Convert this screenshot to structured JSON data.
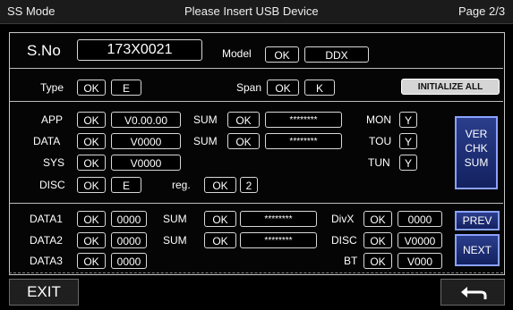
{
  "header": {
    "mode": "SS Mode",
    "message": "Please Insert USB Device",
    "page": "Page 2/3"
  },
  "info": {
    "sno_label": "S.No",
    "sno_value": "173X0021",
    "model_label": "Model",
    "model_status": "OK",
    "model_value": "DDX",
    "type_label": "Type",
    "type_status": "OK",
    "type_value": "E",
    "span_label": "Span",
    "span_status": "OK",
    "span_value": "K",
    "initialize_label": "INITIALIZE ALL"
  },
  "firmware": {
    "app_label": "APP",
    "app_status": "OK",
    "app_value": "V0.00.00",
    "data_label": "DATA",
    "data_status": "OK",
    "data_value": "V0000",
    "sys_label": "SYS",
    "sys_status": "OK",
    "sys_value": "V0000",
    "disc_label": "DISC",
    "disc_status": "OK",
    "disc_value": "E",
    "reg_label": "reg.",
    "reg_status": "OK",
    "reg_value": "2",
    "sum_label": "SUM",
    "sum1_status": "OK",
    "sum1_value": "********",
    "sum2_status": "OK",
    "sum2_value": "********",
    "mon_label": "MON",
    "mon_value": "Y",
    "tou_label": "TOU",
    "tou_value": "Y",
    "tun_label": "TUN",
    "tun_value": "Y",
    "verchk_line1": "VER",
    "verchk_line2": "CHK",
    "verchk_line3": "SUM"
  },
  "data_rows": {
    "data1_label": "DATA1",
    "data1_status": "OK",
    "data1_value": "0000",
    "data1_sum_label": "SUM",
    "data1_sum_status": "OK",
    "data1_sum_value": "********",
    "data2_label": "DATA2",
    "data2_status": "OK",
    "data2_value": "0000",
    "data2_sum_label": "SUM",
    "data2_sum_status": "OK",
    "data2_sum_value": "********",
    "data3_label": "DATA3",
    "data3_status": "OK",
    "data3_value": "0000",
    "divx_label": "DivX",
    "divx_status": "OK",
    "divx_value": "0000",
    "disc_label": "DISC",
    "disc_status": "OK",
    "disc_value": "V0000",
    "bt_label": "BT",
    "bt_status": "OK",
    "bt_value": "V000",
    "prev_label": "PREV",
    "next_label": "NEXT"
  },
  "footer": {
    "exit_label": "EXIT",
    "back_icon": "return-arrow-icon"
  }
}
